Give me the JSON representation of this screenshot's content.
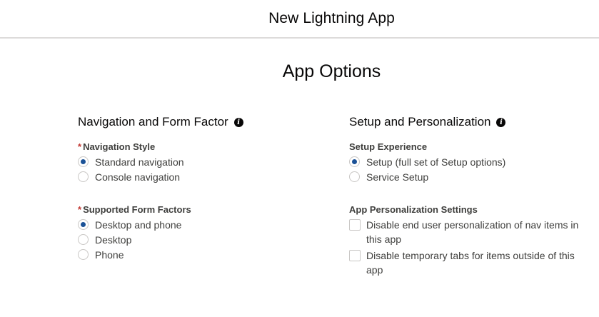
{
  "modal": {
    "title": "New Lightning App"
  },
  "section": {
    "title": "App Options"
  },
  "left": {
    "heading": "Navigation and Form Factor",
    "navigation_style": {
      "label": "Navigation Style",
      "required_mark": "*",
      "options": [
        {
          "label": "Standard navigation",
          "selected": true
        },
        {
          "label": "Console navigation",
          "selected": false
        }
      ]
    },
    "form_factors": {
      "label": "Supported Form Factors",
      "required_mark": "*",
      "options": [
        {
          "label": "Desktop and phone",
          "selected": true
        },
        {
          "label": "Desktop",
          "selected": false
        },
        {
          "label": "Phone",
          "selected": false
        }
      ]
    }
  },
  "right": {
    "heading": "Setup and Personalization",
    "setup_experience": {
      "label": "Setup Experience",
      "options": [
        {
          "label": "Setup (full set of Setup options)",
          "selected": true
        },
        {
          "label": "Service Setup",
          "selected": false
        }
      ]
    },
    "personalization": {
      "label": "App Personalization Settings",
      "options": [
        {
          "label": "Disable end user personalization of nav items in this app",
          "checked": false
        },
        {
          "label": "Disable temporary tabs for items outside of this app",
          "checked": false
        }
      ]
    }
  },
  "icons": {
    "info": "info-icon",
    "info_glyph": "i"
  },
  "colors": {
    "selected_radio": "#1b5297",
    "required": "#c23934"
  }
}
